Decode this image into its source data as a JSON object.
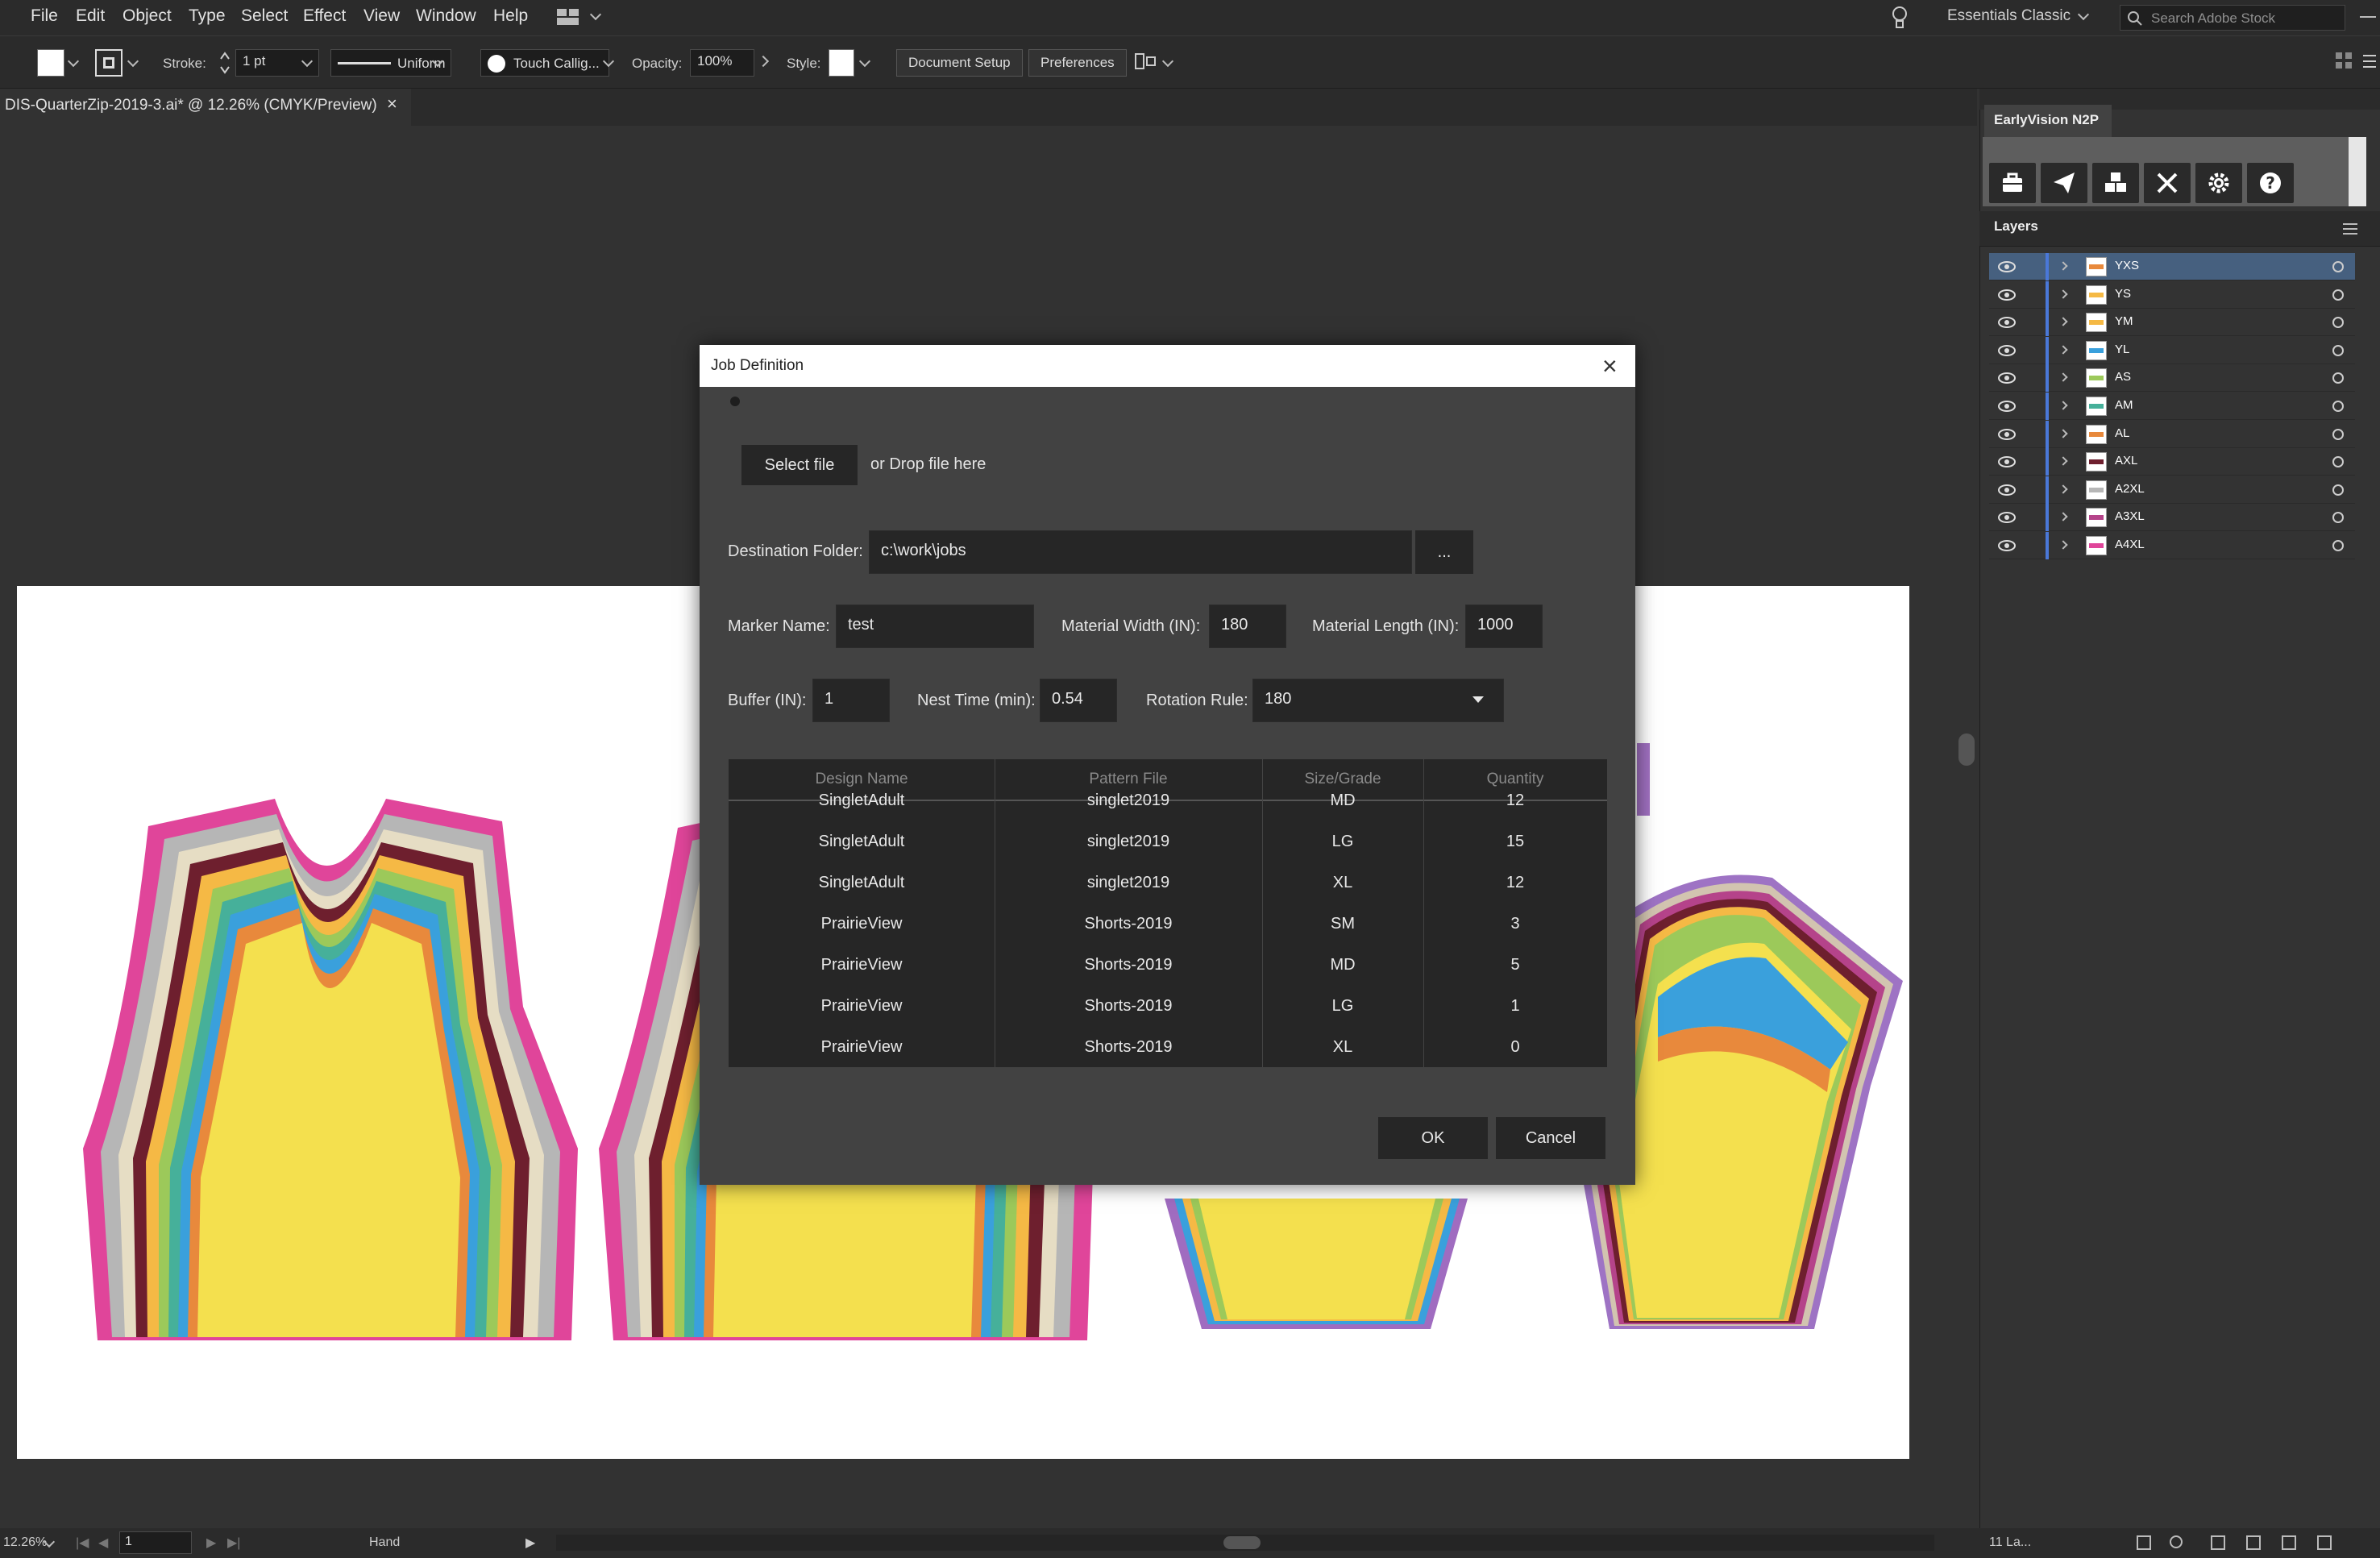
{
  "menu": [
    "File",
    "Edit",
    "Object",
    "Type",
    "Select",
    "Effect",
    "View",
    "Window",
    "Help"
  ],
  "topbar": {
    "workspace": "Essentials Classic",
    "search_placeholder": "Search Adobe Stock"
  },
  "control": {
    "stroke_label": "Stroke:",
    "stroke_value": "1 pt",
    "uniform_label": "Uniform",
    "brush_label": "Touch Callig...",
    "opacity_label": "Opacity:",
    "opacity_value": "100%",
    "style_label": "Style:",
    "document_setup": "Document Setup",
    "preferences": "Preferences"
  },
  "document": {
    "tab_title": "DIS-QuarterZip-2019-3.ai* @ 12.26% (CMYK/Preview)",
    "close": "×"
  },
  "plugin": {
    "tab_label": "EarlyVision N2P"
  },
  "layers": {
    "title": "Layers",
    "items": [
      "YXS",
      "YS",
      "YM",
      "YL",
      "AS",
      "AM",
      "AL",
      "AXL",
      "A2XL",
      "A3XL",
      "A4XL"
    ],
    "count_label": "11 La..."
  },
  "status": {
    "zoom": "12.26%",
    "artboard": "1",
    "tool": "Hand"
  },
  "dialog": {
    "title": "Job Definition",
    "close": "×",
    "select_file": "Select file",
    "drop_text": "or Drop file here",
    "destination_label": "Destination Folder:",
    "destination_value": "c:\\work\\jobs",
    "browse": "...",
    "marker_label": "Marker Name:",
    "marker_value": "test",
    "width_label": "Material Width (IN):",
    "width_value": "180",
    "length_label": "Material Length (IN):",
    "length_value": "1000",
    "buffer_label": "Buffer (IN):",
    "buffer_value": "1",
    "nest_label": "Nest Time (min):",
    "nest_value": "0.54",
    "rotation_label": "Rotation Rule:",
    "rotation_value": "180",
    "columns": [
      "Design Name",
      "Pattern File",
      "Size/Grade",
      "Quantity"
    ],
    "rows": [
      [
        "SingletAdult",
        "singlet2019",
        "MD",
        "12"
      ],
      [
        "SingletAdult",
        "singlet2019",
        "LG",
        "15"
      ],
      [
        "SingletAdult",
        "singlet2019",
        "XL",
        "12"
      ],
      [
        "PrairieView",
        "Shorts-2019",
        "SM",
        "3"
      ],
      [
        "PrairieView",
        "Shorts-2019",
        "MD",
        "5"
      ],
      [
        "PrairieView",
        "Shorts-2019",
        "LG",
        "1"
      ],
      [
        "PrairieView",
        "Shorts-2019",
        "XL",
        "0"
      ]
    ],
    "ok": "OK",
    "cancel": "Cancel"
  },
  "colors": {
    "accent_blue": "#4a78d8",
    "selected_row": "#46607f"
  }
}
